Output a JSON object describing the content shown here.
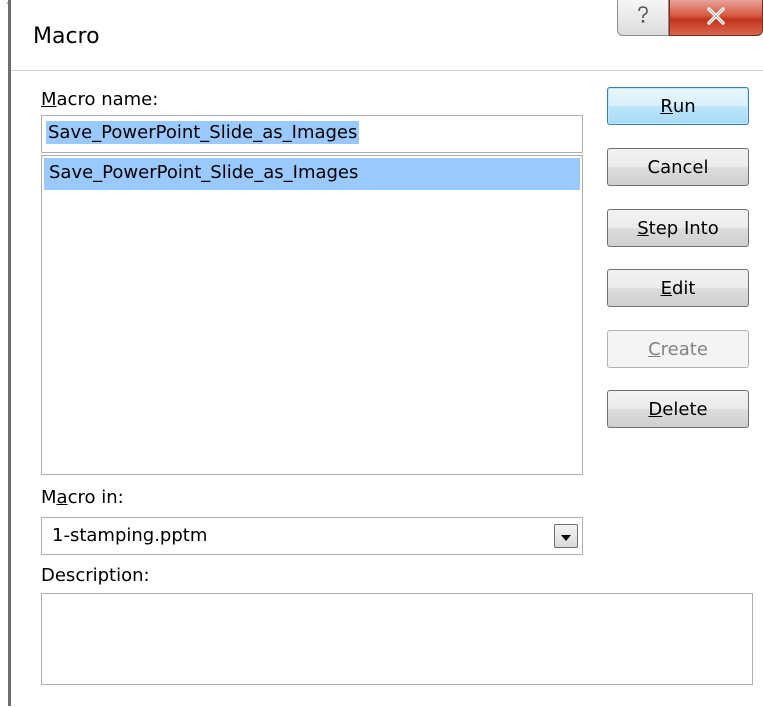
{
  "window": {
    "title": "Macro",
    "help_icon": "question-icon",
    "close_icon": "close-x-icon"
  },
  "macro_name": {
    "label_accel": "M",
    "label_rest": "acro name:",
    "value": "Save_PowerPoint_Slide_as_Images"
  },
  "macro_list": {
    "items": [
      "Save_PowerPoint_Slide_as_Images"
    ]
  },
  "macro_in": {
    "label_pre": "M",
    "label_accel": "a",
    "label_rest": "cro in:",
    "value": "1-stamping.pptm",
    "arrow_icon": "chevron-down-icon"
  },
  "description": {
    "label": "Description:",
    "value": ""
  },
  "buttons": {
    "run": {
      "accel": "R",
      "rest": "un"
    },
    "cancel": {
      "label": "Cancel"
    },
    "step_into": {
      "accel": "S",
      "rest": "tep Into"
    },
    "edit": {
      "accel": "E",
      "rest": "dit"
    },
    "create": {
      "accel": "C",
      "rest": "reate"
    },
    "delete": {
      "accel": "D",
      "rest": "elete"
    }
  },
  "colors": {
    "selection": "#99c9ff",
    "close_button": "#c7402a",
    "default_button_border": "#3c7fb1"
  }
}
